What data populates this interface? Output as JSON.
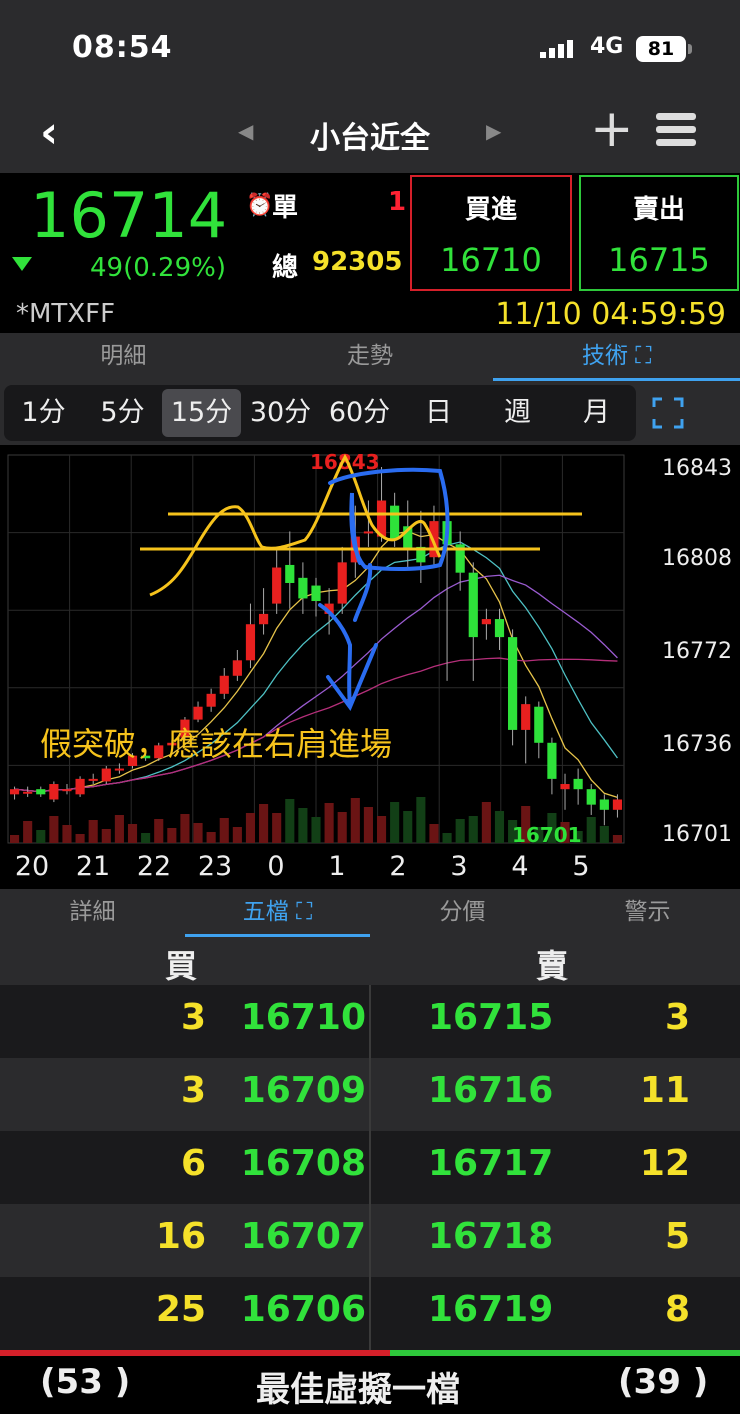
{
  "status": {
    "time": "08:54",
    "network": "4G",
    "battery": "81"
  },
  "nav": {
    "title": "小台近全"
  },
  "quote": {
    "price": "16714",
    "change": "49(0.29%)",
    "single_label": "單",
    "single_value": "1",
    "total_label": "總",
    "total_value": "92305",
    "buy_label": "買進",
    "buy_price": "16710",
    "sell_label": "賣出",
    "sell_price": "16715",
    "symbol": "*MTXFF",
    "timestamp": "11/10 04:59:59"
  },
  "tabs_top": [
    "明細",
    "走勢",
    "技術"
  ],
  "periods": [
    "1分",
    "5分",
    "15分",
    "30分",
    "60分",
    "日",
    "週",
    "月"
  ],
  "selected_period": "15分",
  "chart_data": {
    "type": "candlestick",
    "x_labels": [
      "20",
      "21",
      "22",
      "23",
      "0",
      "1",
      "2",
      "3",
      "4",
      "5"
    ],
    "y_ticks": [
      "16843",
      "16808",
      "16772",
      "16736",
      "16701"
    ],
    "high_label": "16843",
    "low_label": "16701",
    "ylim": [
      16701,
      16843
    ],
    "annotation": "假突破，應該在右肩進場",
    "candles": [
      [
        16716,
        16718,
        16714,
        16719
      ],
      [
        16717,
        16717,
        16715,
        16719
      ],
      [
        16718,
        16716,
        16715,
        16719
      ],
      [
        16714,
        16720,
        16713,
        16721
      ],
      [
        16718,
        16718,
        16716,
        16720
      ],
      [
        16716,
        16722,
        16715,
        16723
      ],
      [
        16722,
        16722,
        16720,
        16724
      ],
      [
        16721,
        16726,
        16720,
        16727
      ],
      [
        16726,
        16726,
        16724,
        16728
      ],
      [
        16727,
        16731,
        16726,
        16732
      ],
      [
        16731,
        16730,
        16729,
        16733
      ],
      [
        16730,
        16735,
        16729,
        16736
      ],
      [
        16735,
        16736,
        16733,
        16737
      ],
      [
        16738,
        16745,
        16737,
        16746
      ],
      [
        16745,
        16750,
        16744,
        16752
      ],
      [
        16750,
        16755,
        16748,
        16757
      ],
      [
        16755,
        16762,
        16753,
        16765
      ],
      [
        16762,
        16768,
        16760,
        16772
      ],
      [
        16768,
        16782,
        16765,
        16790
      ],
      [
        16782,
        16786,
        16778,
        16796
      ],
      [
        16790,
        16804,
        16786,
        16812
      ],
      [
        16805,
        16798,
        16788,
        16818
      ],
      [
        16800,
        16792,
        16786,
        16806
      ],
      [
        16797,
        16791,
        16785,
        16800
      ],
      [
        16786,
        16790,
        16778,
        16796
      ],
      [
        16790,
        16806,
        16786,
        16812
      ],
      [
        16806,
        16816,
        16800,
        16828
      ],
      [
        16818,
        16818,
        16812,
        16830
      ],
      [
        16816,
        16830,
        16814,
        16843
      ],
      [
        16828,
        16815,
        16812,
        16833
      ],
      [
        16820,
        16811,
        16804,
        16830
      ],
      [
        16812,
        16806,
        16798,
        16826
      ],
      [
        16808,
        16822,
        16804,
        16828
      ],
      [
        16822,
        16813,
        16760,
        16826
      ],
      [
        16813,
        16802,
        16795,
        16818
      ],
      [
        16802,
        16777,
        16760,
        16806
      ],
      [
        16782,
        16784,
        16776,
        16788
      ],
      [
        16784,
        16777,
        16772,
        16788
      ],
      [
        16777,
        16741,
        16735,
        16780
      ],
      [
        16741,
        16751,
        16728,
        16754
      ],
      [
        16750,
        16736,
        16730,
        16752
      ],
      [
        16736,
        16722,
        16716,
        16738
      ],
      [
        16718,
        16720,
        16710,
        16724
      ],
      [
        16722,
        16718,
        16712,
        16726
      ],
      [
        16718,
        16712,
        16708,
        16720
      ],
      [
        16714,
        16710,
        16704,
        16716
      ],
      [
        16710,
        16714,
        16707,
        16716
      ]
    ]
  },
  "tabs_bottom": [
    "詳細",
    "五檔",
    "分價",
    "警示"
  ],
  "orderbook": {
    "buy_header": "買",
    "sell_header": "賣",
    "rows": [
      {
        "bq": "3",
        "bp": "16710",
        "ap": "16715",
        "aq": "3"
      },
      {
        "bq": "3",
        "bp": "16709",
        "ap": "16716",
        "aq": "11"
      },
      {
        "bq": "6",
        "bp": "16708",
        "ap": "16717",
        "aq": "12"
      },
      {
        "bq": "16",
        "bp": "16707",
        "ap": "16718",
        "aq": "5"
      },
      {
        "bq": "25",
        "bp": "16706",
        "ap": "16719",
        "aq": "8"
      }
    ],
    "buy_total": "(53 )",
    "sell_total": "(39 )",
    "footer_label": "最佳虛擬一檔"
  },
  "colors": {
    "up": "#e8201f",
    "down": "#2ee23a",
    "accent": "#3fa2ef",
    "yellow": "#f5e12a"
  }
}
